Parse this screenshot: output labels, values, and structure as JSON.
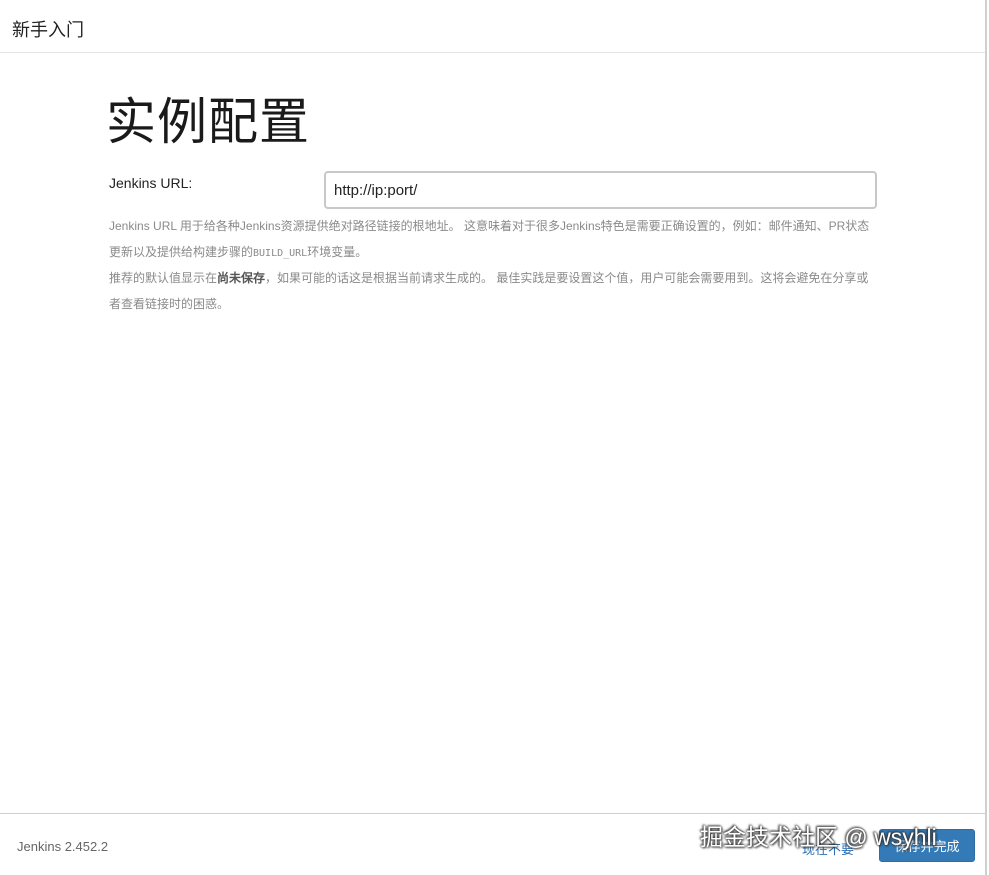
{
  "header": {
    "title": "新手入门"
  },
  "main": {
    "page_title": "实例配置",
    "url_label": "Jenkins URL:",
    "url_value": "http://ip:port/",
    "help": {
      "p1_text_a": "Jenkins URL 用于给各种Jenkins资源提供绝对路径链接的根地址。 这意味着对于很多Jenkins特色是需要正确设置的，例如：邮件通知、PR状态更新以及提供给构建步骤的",
      "p1_code": "BUILD_URL",
      "p1_text_b": "环境变量。",
      "p2_text_a": "推荐的默认值显示在",
      "p2_bold": "尚未保存",
      "p2_text_b": "，如果可能的话这是根据当前请求生成的。 最佳实践是要设置这个值，用户可能会需要用到。这将会避免在分享或者查看链接时的困惑。"
    }
  },
  "footer": {
    "version": "Jenkins 2.452.2",
    "skip_label": "现在不要",
    "save_label": "保存并完成"
  },
  "watermark": "掘金技术社区 @ wsyhli",
  "colors": {
    "primary_button": "#337ab7",
    "link": "#2a6db0",
    "help_text": "#8a8a8a"
  }
}
